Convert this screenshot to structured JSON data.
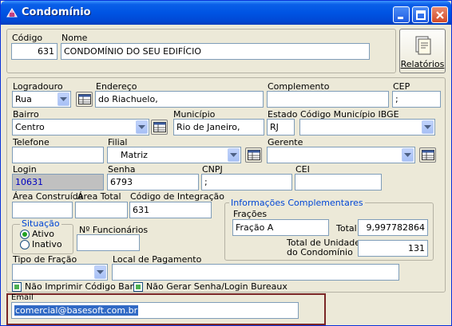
{
  "window": {
    "title": "Condomínio"
  },
  "header": {
    "codigo_label": "Código",
    "codigo_value": "631",
    "nome_label": "Nome",
    "nome_value": "CONDOMÍNIO DO SEU EDIFÍCIO",
    "relatorios_label": "Relatórios"
  },
  "address": {
    "logradouro_label": "Logradouro",
    "logradouro_value": "Rua",
    "endereco_label": "Endereço",
    "endereco_value": "do Riachuelo,",
    "complemento_label": "Complemento",
    "complemento_value": "",
    "cep_label": "CEP",
    "cep_value": ";",
    "bairro_label": "Bairro",
    "bairro_value": "Centro",
    "municipio_label": "Município",
    "municipio_value": "Rio de Janeiro,",
    "estado_label": "Estado",
    "estado_value": "RJ",
    "ibge_label": "Código Município IBGE",
    "ibge_value": ""
  },
  "contact": {
    "telefone_label": "Telefone",
    "telefone_value": "",
    "filial_label": "Filial",
    "filial_value": "Matriz",
    "gerente_label": "Gerente",
    "gerente_value": ""
  },
  "access": {
    "login_label": "Login",
    "login_value": "10631",
    "senha_label": "Senha",
    "senha_value": "6793",
    "cnpj_label": "CNPJ",
    "cnpj_value": ";",
    "cei_label": "CEI",
    "cei_value": ""
  },
  "areas": {
    "construida_label": "Área Construída",
    "construida_value": "",
    "total_label": "Área Total",
    "total_value": "",
    "integracao_label": "Código de Integração",
    "integracao_value": "631"
  },
  "situacao": {
    "label": "Situação",
    "ativo_label": "Ativo",
    "inativo_label": "Inativo",
    "selected": "Ativo"
  },
  "funcionarios": {
    "label": "Nº Funcionários",
    "value": ""
  },
  "info": {
    "title": "Informações Complementares",
    "fracoes_label": "Frações",
    "fracao_value": "Fração A",
    "total_label": "Total",
    "total_value": "9,997782864",
    "unidades_label_1": "Total de Unidades",
    "unidades_label_2": "do Condomínio",
    "unidades_value": "131"
  },
  "bottom": {
    "tipo_fracao_label": "Tipo de Fração",
    "tipo_fracao_value": "",
    "local_pagamento_label": "Local de Pagamento",
    "local_pagamento_value": "",
    "check1_label": "Não Imprimir Código Barra",
    "check2_label": "Não Gerar Senha/Login Bureaux",
    "email_label": "Email",
    "email_value": "comercial@basesoft.com.br"
  },
  "colors": {
    "titlebar": "#0054e3",
    "group_title": "#0046d5",
    "email_highlight": "#7a2626",
    "selection": "#316ac5"
  }
}
